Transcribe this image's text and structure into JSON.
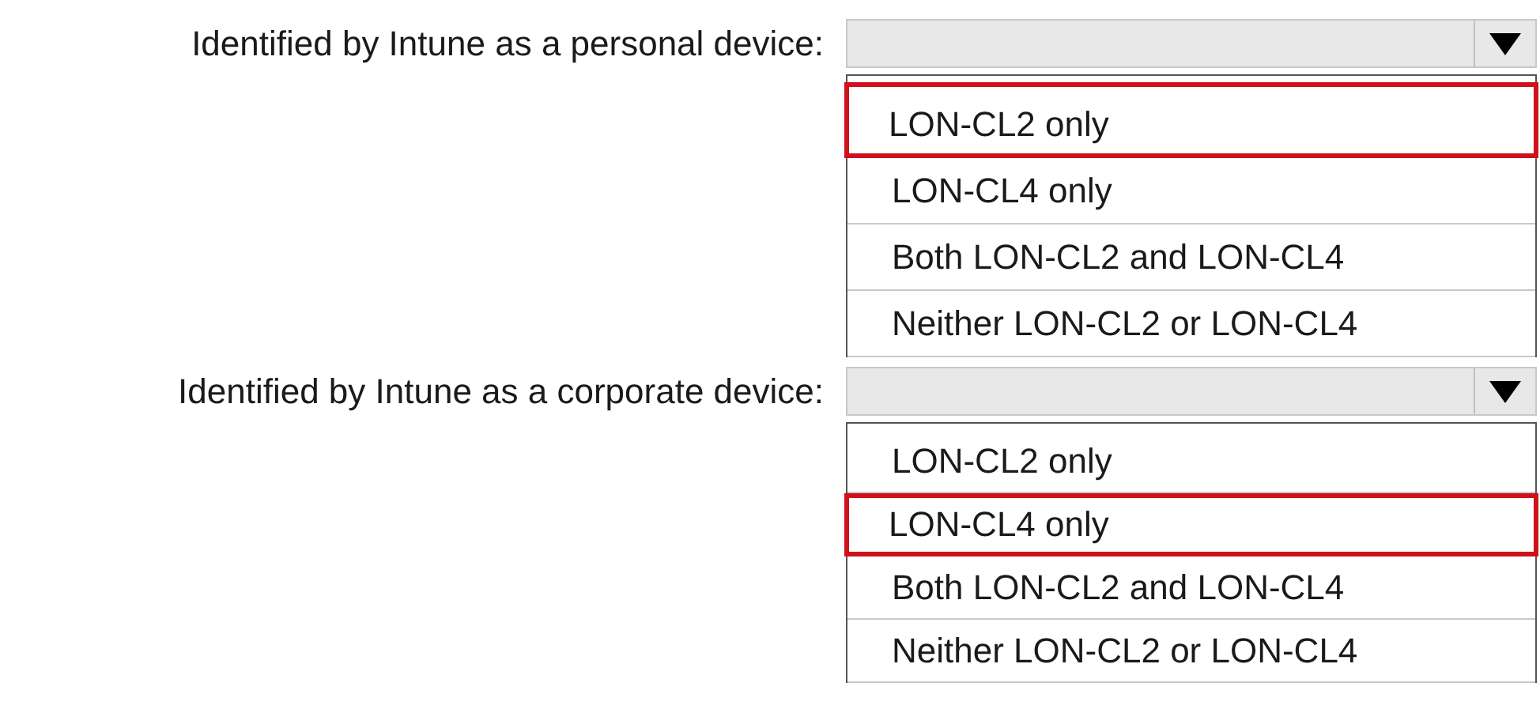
{
  "questions": [
    {
      "label": "Identified by Intune as a personal device:",
      "options": [
        {
          "text": "LON-CL2 only",
          "selected": true
        },
        {
          "text": "LON-CL4 only",
          "selected": false
        },
        {
          "text": "Both LON-CL2 and LON-CL4",
          "selected": false
        },
        {
          "text": "Neither LON-CL2 or LON-CL4",
          "selected": false
        }
      ]
    },
    {
      "label": "Identified by Intune as a corporate device:",
      "options": [
        {
          "text": "LON-CL2 only",
          "selected": false
        },
        {
          "text": "LON-CL4 only",
          "selected": true
        },
        {
          "text": "Both LON-CL2 and LON-CL4",
          "selected": false
        },
        {
          "text": "Neither LON-CL2 or LON-CL4",
          "selected": false
        }
      ]
    }
  ]
}
